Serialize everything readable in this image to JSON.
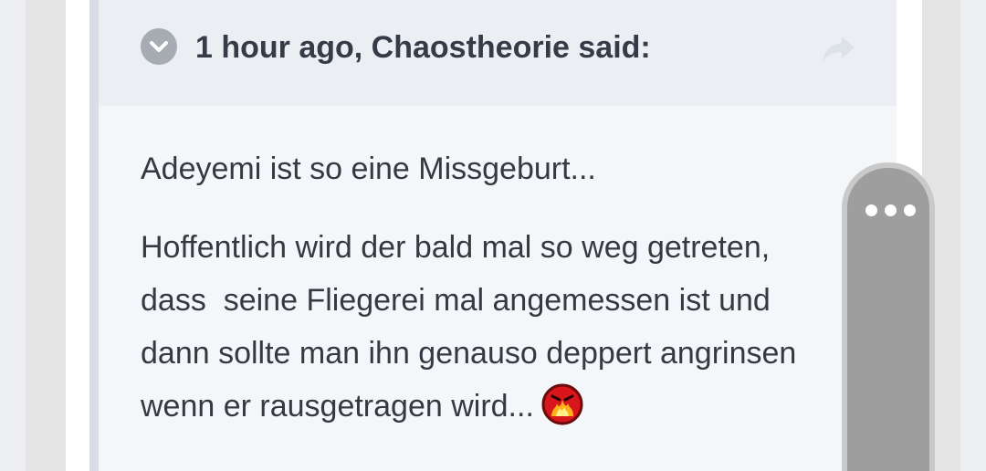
{
  "quote": {
    "citation": "1 hour ago, Chaostheorie said:",
    "toggle_icon": "chevron-down-icon",
    "share_icon": "share-arrow-icon",
    "paragraph1": "Adeyemi ist so eine Missgeburt...",
    "paragraph2_lines": [
      "Hoffentlich wird der bald mal so weg getreten,",
      "dass  seine Fliegerei mal angemessen ist und",
      "dann sollte man ihn genauso deppert angrinsen",
      "wenn er rausgetragen wird..."
    ],
    "emoji": "angry-fire-emoji"
  },
  "scroll_handle": {
    "menu_icon": "more-dots-icon"
  },
  "colors": {
    "quote_header_bg": "#ebeff4",
    "quote_body_bg": "#f4f7fa",
    "quote_border": "#d9dee6",
    "text": "#353a42",
    "handle": "#9e9e9e"
  }
}
